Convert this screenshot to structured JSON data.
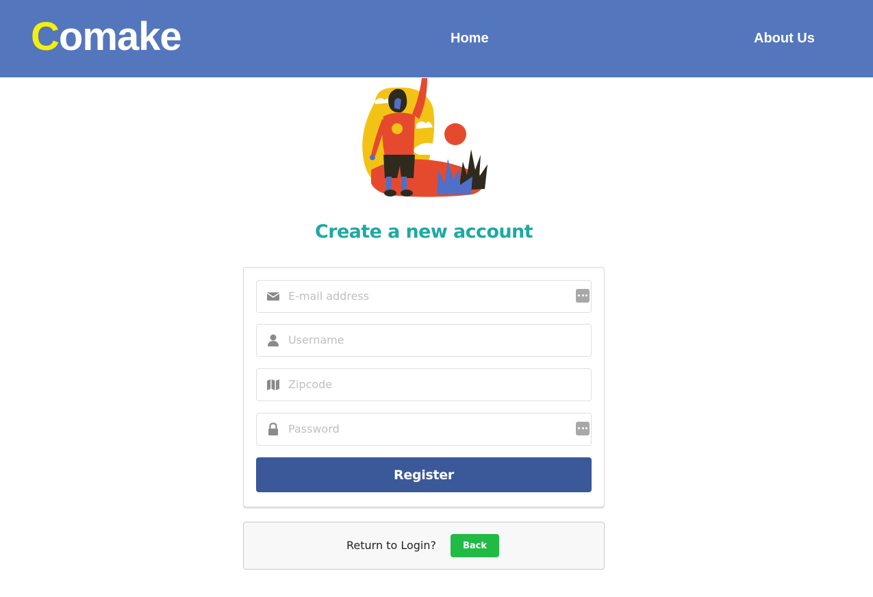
{
  "navbar": {
    "logo_first": "C",
    "logo_rest": "omake",
    "links": [
      "Home",
      "About Us"
    ],
    "color": "#5476bd",
    "logo_accent": "#f4f00a"
  },
  "hero": {
    "icon": "person-reaching-sun-illustration"
  },
  "main": {
    "heading": "Create a new account",
    "heading_color": "#1ea9a3"
  },
  "form": {
    "fields": [
      {
        "icon": "envelope-icon",
        "placeholder": "E-mail address",
        "value": ""
      },
      {
        "icon": "user-icon",
        "placeholder": "Username",
        "value": ""
      },
      {
        "icon": "map-icon",
        "placeholder": "Zipcode",
        "value": ""
      },
      {
        "icon": "lock-icon",
        "placeholder": "Password",
        "value": ""
      }
    ],
    "register_label": "Register",
    "register_color": "#3b5998"
  },
  "return": {
    "text": "Return to Login?",
    "back_label": "Back",
    "back_color": "#21ba45"
  }
}
